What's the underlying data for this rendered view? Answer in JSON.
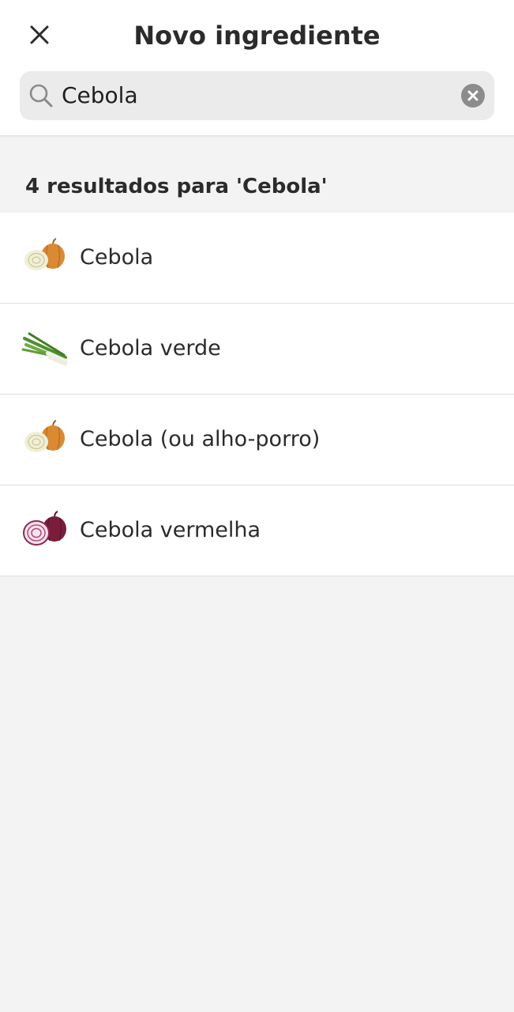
{
  "header": {
    "title": "Novo ingrediente",
    "close_icon": "close-icon"
  },
  "search": {
    "value": "Cebola",
    "icon": "search-icon",
    "clear_icon": "clear-icon"
  },
  "results": {
    "summary": "4 resultados para 'Cebola'",
    "items": [
      {
        "label": "Cebola",
        "icon": "onion-icon"
      },
      {
        "label": "Cebola verde",
        "icon": "green-onion-icon"
      },
      {
        "label": "Cebola (ou alho-porro)",
        "icon": "onion-icon"
      },
      {
        "label": "Cebola vermelha",
        "icon": "red-onion-icon"
      }
    ]
  },
  "colors": {
    "background": "#f3f3f3",
    "surface": "#ffffff",
    "search_field": "#ebebeb",
    "text": "#2b2b2b",
    "divider": "#dedede"
  }
}
